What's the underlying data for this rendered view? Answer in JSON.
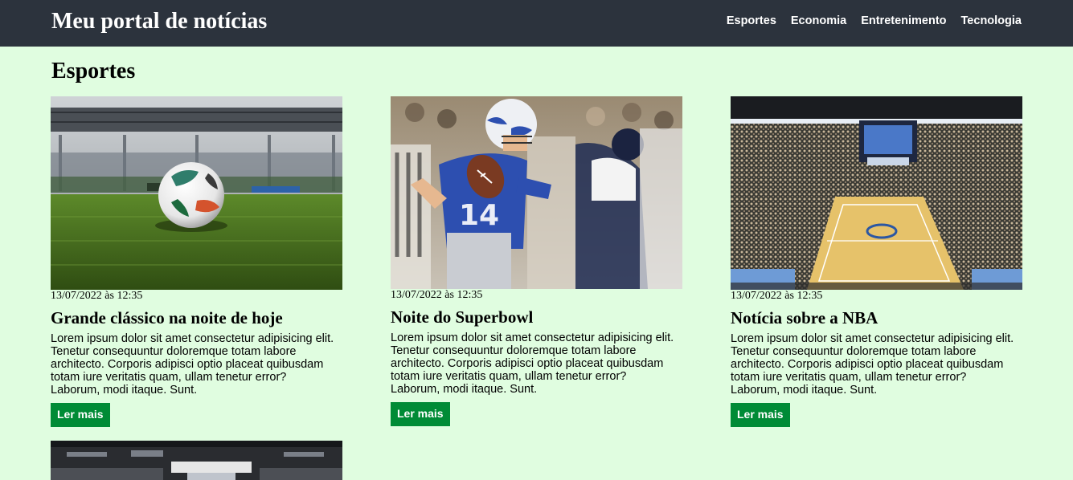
{
  "header": {
    "brand": "Meu portal de notícias",
    "nav": [
      "Esportes",
      "Economia",
      "Entretenimento",
      "Tecnologia"
    ]
  },
  "section": {
    "title": "Esportes"
  },
  "articles": [
    {
      "image": "soccer-ball-on-pitch",
      "date": "13/07/2022 às 12:35",
      "title": "Grande clássico na noite de hoje",
      "excerpt": "Lorem ipsum dolor sit amet consectetur adipisicing elit. Tenetur consequuntur doloremque totam labore architecto. Corporis adipisci optio placeat quibusdam totam iure veritatis quam, ullam tenetur error? Laborum, modi itaque. Sunt.",
      "button": "Ler mais"
    },
    {
      "image": "american-football-quarterback",
      "date": "13/07/2022 às 12:35",
      "title": "Noite do Superbowl",
      "excerpt": "Lorem ipsum dolor sit amet consectetur adipisicing elit. Tenetur consequuntur doloremque totam labore architecto. Corporis adipisci optio placeat quibusdam totam iure veritatis quam, ullam tenetur error? Laborum, modi itaque. Sunt.",
      "button": "Ler mais"
    },
    {
      "image": "basketball-arena",
      "date": "13/07/2022 às 12:35",
      "title": "Notícia sobre a NBA",
      "excerpt": "Lorem ipsum dolor sit amet consectetur adipisicing elit. Tenetur consequuntur doloremque totam labore architecto. Corporis adipisci optio placeat quibusdam totam iure veritatis quam, ullam tenetur error? Laborum, modi itaque. Sunt.",
      "button": "Ler mais"
    }
  ],
  "colors": {
    "header_bg": "#2c333d",
    "page_bg": "#e0fde0",
    "button_bg": "#008b36"
  }
}
